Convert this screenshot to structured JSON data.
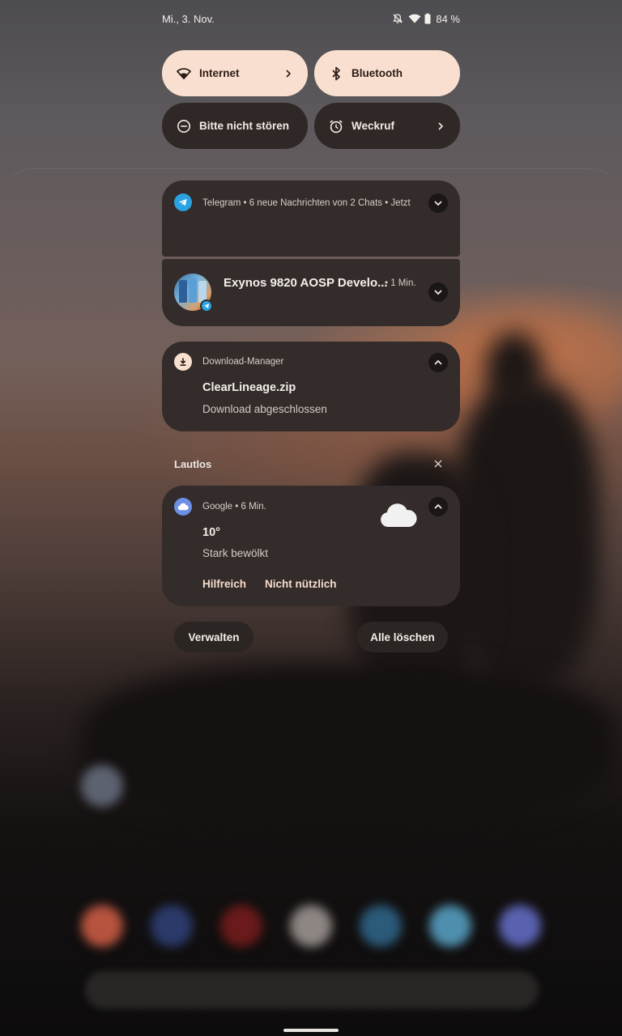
{
  "status_bar": {
    "date": "Mi., 3. Nov.",
    "battery": "84 %",
    "icons": [
      "bell-off-icon",
      "wifi-icon",
      "battery-icon"
    ]
  },
  "quick_settings": [
    {
      "label": "Internet",
      "icon": "wifi-icon",
      "active": true,
      "has_chevron": true
    },
    {
      "label": "Bluetooth",
      "icon": "bluetooth-icon",
      "active": true,
      "has_chevron": false
    },
    {
      "label": "Bitte nicht stören",
      "icon": "do-not-disturb-icon",
      "active": false,
      "has_chevron": false
    },
    {
      "label": "Weckruf",
      "icon": "alarm-icon",
      "active": false,
      "has_chevron": true
    }
  ],
  "notifications": {
    "telegram_group": {
      "header": "Telegram • 6 neue Nachrichten von 2 Chats • Jetzt",
      "child_title": "Exynos 9820 AOSP Develo...",
      "child_time": "• 1 Min."
    },
    "download": {
      "app": "Download-Manager",
      "title": "ClearLineage.zip",
      "text": "Download abgeschlossen"
    },
    "silent_section": {
      "label": "Lautlos"
    },
    "google_weather": {
      "header": "Google • 6 Min.",
      "temperature": "10°",
      "condition": "Stark bewölkt",
      "actions": [
        "Hilfreich",
        "Nicht nützlich"
      ]
    }
  },
  "footer": {
    "manage": "Verwalten",
    "clear_all": "Alle löschen"
  },
  "colors": {
    "tile_active": "#f9dfcf",
    "tile_inactive": "#2f2826",
    "card_bg": "#332c2a",
    "accent_text": "#f6dccd",
    "telegram_blue": "#2aa3e0",
    "google_blue": "#6d8fe6"
  }
}
